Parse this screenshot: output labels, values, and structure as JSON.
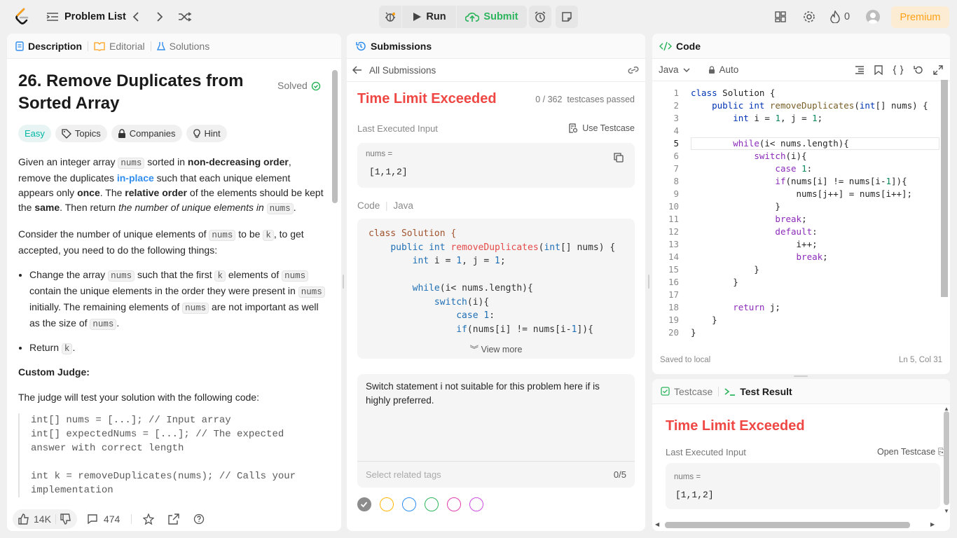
{
  "topbar": {
    "problem_list": "Problem List",
    "run": "Run",
    "submit": "Submit",
    "streak_count": "0",
    "premium": "Premium"
  },
  "left": {
    "tabs": [
      "Description",
      "Editorial",
      "Solutions"
    ],
    "title": "26. Remove Duplicates from Sorted Array",
    "solved": "Solved",
    "chips": [
      "Easy",
      "Topics",
      "Companies",
      "Hint"
    ],
    "custom_judge": "Custom Judge:",
    "judge_intro": "The judge will test your solution with the following code:",
    "judge_code": [
      "int[] nums = [...]; // Input array",
      "int[] expectedNums = [...]; // The expected",
      "answer with correct length",
      "",
      "int k = removeDuplicates(nums); // Calls your",
      "implementation"
    ],
    "likes": "14K",
    "comments": "474"
  },
  "middle": {
    "tab": "Submissions",
    "all_submissions": "All Submissions",
    "status": "Time Limit Exceeded",
    "passed": "0 / 362",
    "passed_suffix": "testcases passed",
    "last_input_label": "Last Executed Input",
    "use_testcase": "Use Testcase",
    "input_name": "nums =",
    "input_value": "[1,1,2]",
    "code_label": "Code",
    "code_lang": "Java",
    "code_lines": [
      "class Solution {",
      "    public int removeDuplicates(int[] nums) {",
      "        int i = 1, j = 1;",
      "",
      "        while(i< nums.length){",
      "            switch(i){",
      "                case 1:",
      "                if(nums[i] != nums[i-1]){"
    ],
    "view_more": "View more",
    "note": "Switch statement i not suitable for this problem here if is highly preferred.",
    "tags_placeholder": "Select related tags",
    "tags_count": "0/5",
    "circle_colors": [
      "#8c8c8c",
      "#ffb800",
      "#2f8ded",
      "#2db55d",
      "#e23eb0",
      "#c74fd9"
    ]
  },
  "code": {
    "tab": "Code",
    "lang": "Java",
    "mode": "Auto",
    "lines": [
      "class Solution {",
      "    public int removeDuplicates(int[] nums) {",
      "        int i = 1, j = 1;",
      "",
      "        while(i< nums.length){",
      "            switch(i){",
      "                case 1:",
      "                if(nums[i] != nums[i-1]){",
      "                    nums[j++] = nums[i++];",
      "                }",
      "                break;",
      "                default:",
      "                    i++;",
      "                    break;",
      "            }",
      "        }",
      "",
      "        return j;",
      "    }",
      "}"
    ],
    "saved": "Saved to local",
    "cursor": "Ln 5, Col 31"
  },
  "result": {
    "tabs": [
      "Testcase",
      "Test Result"
    ],
    "status": "Time Limit Exceeded",
    "last_input_label": "Last Executed Input",
    "open_testcase": "Open Testcase",
    "input_name": "nums =",
    "input_value": "[1,1,2]"
  }
}
